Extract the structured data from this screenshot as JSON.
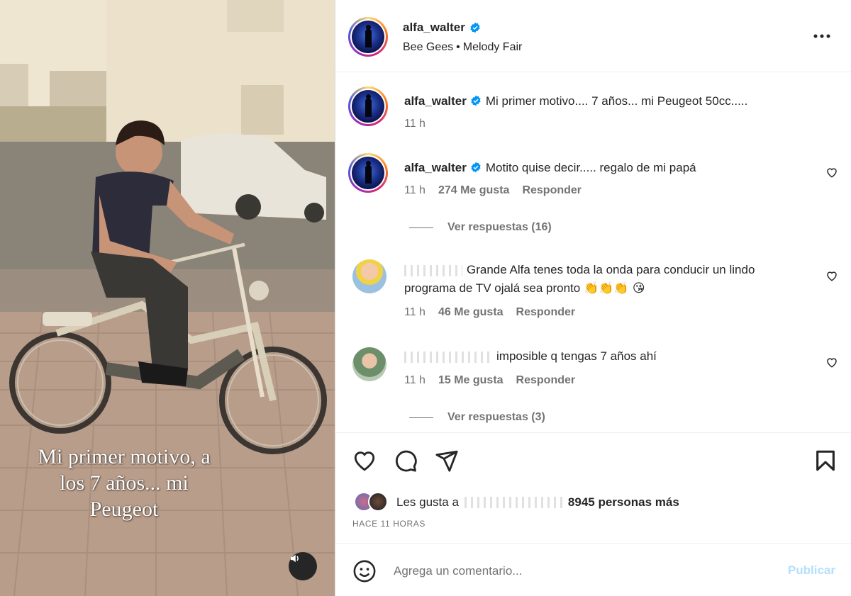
{
  "photo": {
    "caption": "Mi primer motivo, a los 7 años... mi Peugeot",
    "audio_icon": "speaker-icon"
  },
  "header": {
    "username": "alfa_walter",
    "song_artist": "Bee Gees",
    "song_separator": "•",
    "song_title": "Melody Fair",
    "more_icon": "more-horizontal-icon"
  },
  "caption_comment": {
    "username": "alfa_walter",
    "text": "Mi primer motivo.... 7 años... mi Peugeot 50cc.....",
    "time": "11 h"
  },
  "comments": [
    {
      "username": "alfa_walter",
      "text": "Motito quise decir..... regalo de mi papá",
      "time": "11 h",
      "likes": "274 Me gusta",
      "reply": "Responder",
      "view_replies": "Ver respuestas (16)"
    },
    {
      "username": "",
      "text": "Grande Alfa tenes toda la onda para conducir un lindo programa de TV ojalá sea pronto",
      "emojis": "👏👏👏 😘",
      "time": "11 h",
      "likes": "46 Me gusta",
      "reply": "Responder"
    },
    {
      "username": "",
      "text": "imposible q tengas 7 años ahí",
      "time": "11 h",
      "likes": "15 Me gusta",
      "reply": "Responder",
      "view_replies": "Ver respuestas (3)"
    }
  ],
  "actions": {
    "icons": [
      "heart-icon",
      "comment-icon",
      "share-icon",
      "bookmark-icon"
    ],
    "likes_prefix": "Les gusta a",
    "likes_suffix": "8945 personas más",
    "timestamp": "HACE 11 HORAS"
  },
  "add_comment": {
    "placeholder": "Agrega un comentario...",
    "publish": "Publicar",
    "publish_color": "#b2dffc"
  },
  "colors": {
    "text": "#262626",
    "secondary": "#737373",
    "verified": "#0095f6"
  }
}
